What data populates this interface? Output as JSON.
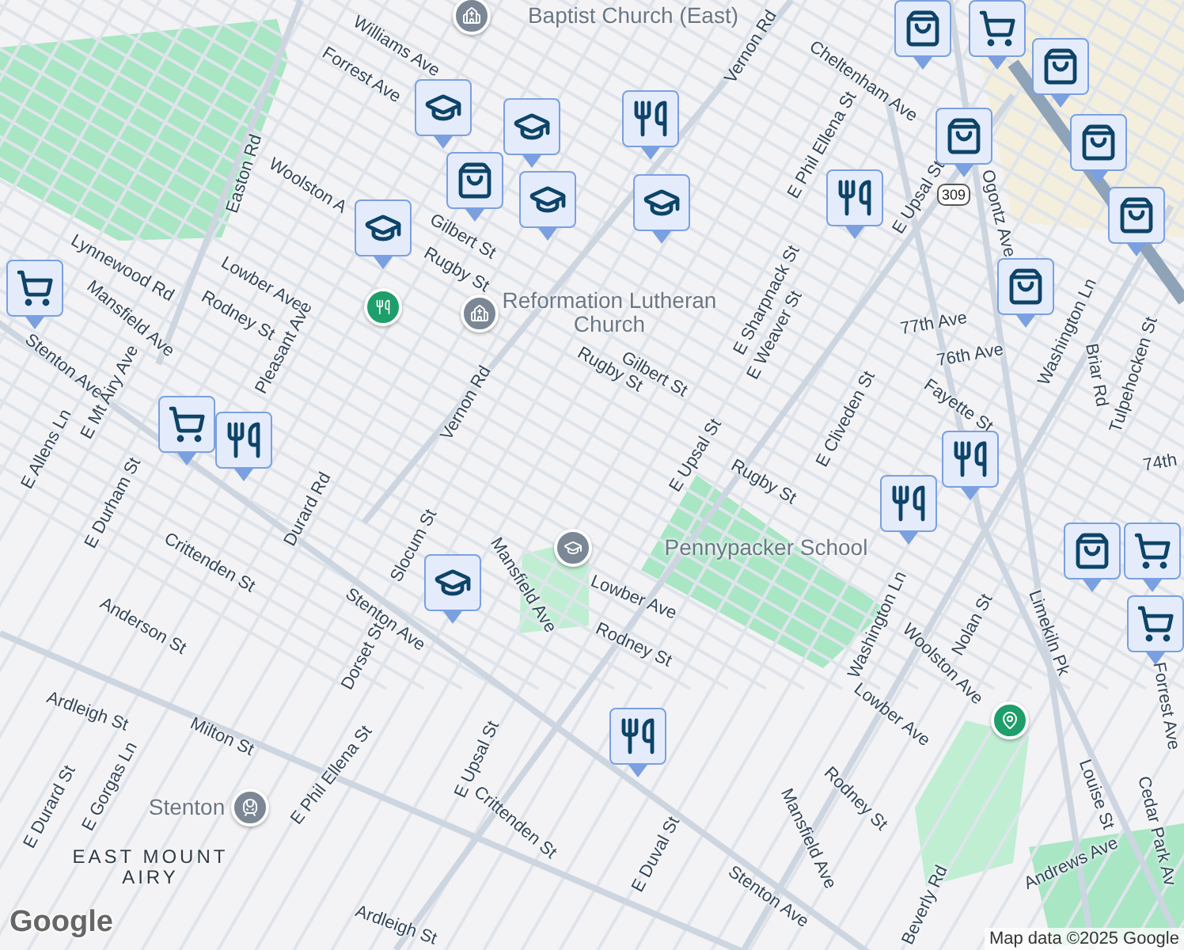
{
  "map": {
    "street_labels": [
      "Williams Ave",
      "Forrest Ave",
      "Vernon Rd",
      "Cheltenham Ave",
      "E Phil Ellena St",
      "Easton Rd",
      "Woolston A",
      "Gilbert St",
      "Rugby St",
      "Lynnewood Rd",
      "Mansfield Ave",
      "Lowber Ave",
      "Rodney St",
      "Pleasant Ave",
      "Stenton Ave",
      "E Mt Airy Ave",
      "E Allens Ln",
      "Vernon Rd",
      "Gilbert St",
      "Rugby St",
      "E Sharpnack St",
      "E Weaver St",
      "E Upsal St",
      "Ogontz Ave",
      "77th Ave",
      "76th Ave",
      "Fayette St",
      "Washington Ln",
      "Briar Rd",
      "Tulpehocken St",
      "E Cliveden St",
      "74th",
      "E Upsal St",
      "Rugby St",
      "E Durham St",
      "Durard Rd",
      "Crittenden St",
      "Slocum St",
      "Anderson St",
      "Dorset St",
      "Stenton Ave",
      "Mansfield Ave",
      "Lowber Ave",
      "Rodney St",
      "Washington Ln",
      "Woolston Ave",
      "Nolan St",
      "Limekiln Pk",
      "Ardleigh St",
      "Milton St",
      "E Phil Ellena St",
      "E Upsal St",
      "Crittenden St",
      "Lowber Ave",
      "Rodney St",
      "Mansfield Ave",
      "E Duval St",
      "Stenton Ave",
      "Beverly Rd",
      "Louise St",
      "Forrest Ave",
      "Cedar Park Av",
      "Andrews Ave",
      "E Durard St",
      "E Gorgas Ln",
      "Ardleigh St"
    ],
    "place_labels": [
      {
        "text": "Baptist Church (East)",
        "kind": "church"
      },
      {
        "text": "Reformation Lutheran Church",
        "kind": "church"
      },
      {
        "text": "Pennypacker School",
        "kind": "school"
      },
      {
        "text": "Stenton",
        "kind": "station"
      },
      {
        "text": "EAST MOUNT AIRY",
        "kind": "area"
      }
    ],
    "markers": [
      {
        "kind": "shopping"
      },
      {
        "kind": "grocery"
      },
      {
        "kind": "shopping"
      },
      {
        "kind": "shopping"
      },
      {
        "kind": "shopping"
      },
      {
        "kind": "shopping"
      },
      {
        "kind": "shopping"
      },
      {
        "kind": "restaurant"
      },
      {
        "kind": "school"
      },
      {
        "kind": "school"
      },
      {
        "kind": "school"
      },
      {
        "kind": "shopping"
      },
      {
        "kind": "school"
      },
      {
        "kind": "school"
      },
      {
        "kind": "restaurant"
      },
      {
        "kind": "grocery"
      },
      {
        "kind": "grocery"
      },
      {
        "kind": "restaurant"
      },
      {
        "kind": "restaurant"
      },
      {
        "kind": "restaurant"
      },
      {
        "kind": "school"
      },
      {
        "kind": "restaurant"
      },
      {
        "kind": "shopping"
      },
      {
        "kind": "grocery"
      },
      {
        "kind": "grocery"
      }
    ],
    "highway_shield": "309",
    "attribution": "Map data ©2025 Google",
    "logo": "Google"
  }
}
